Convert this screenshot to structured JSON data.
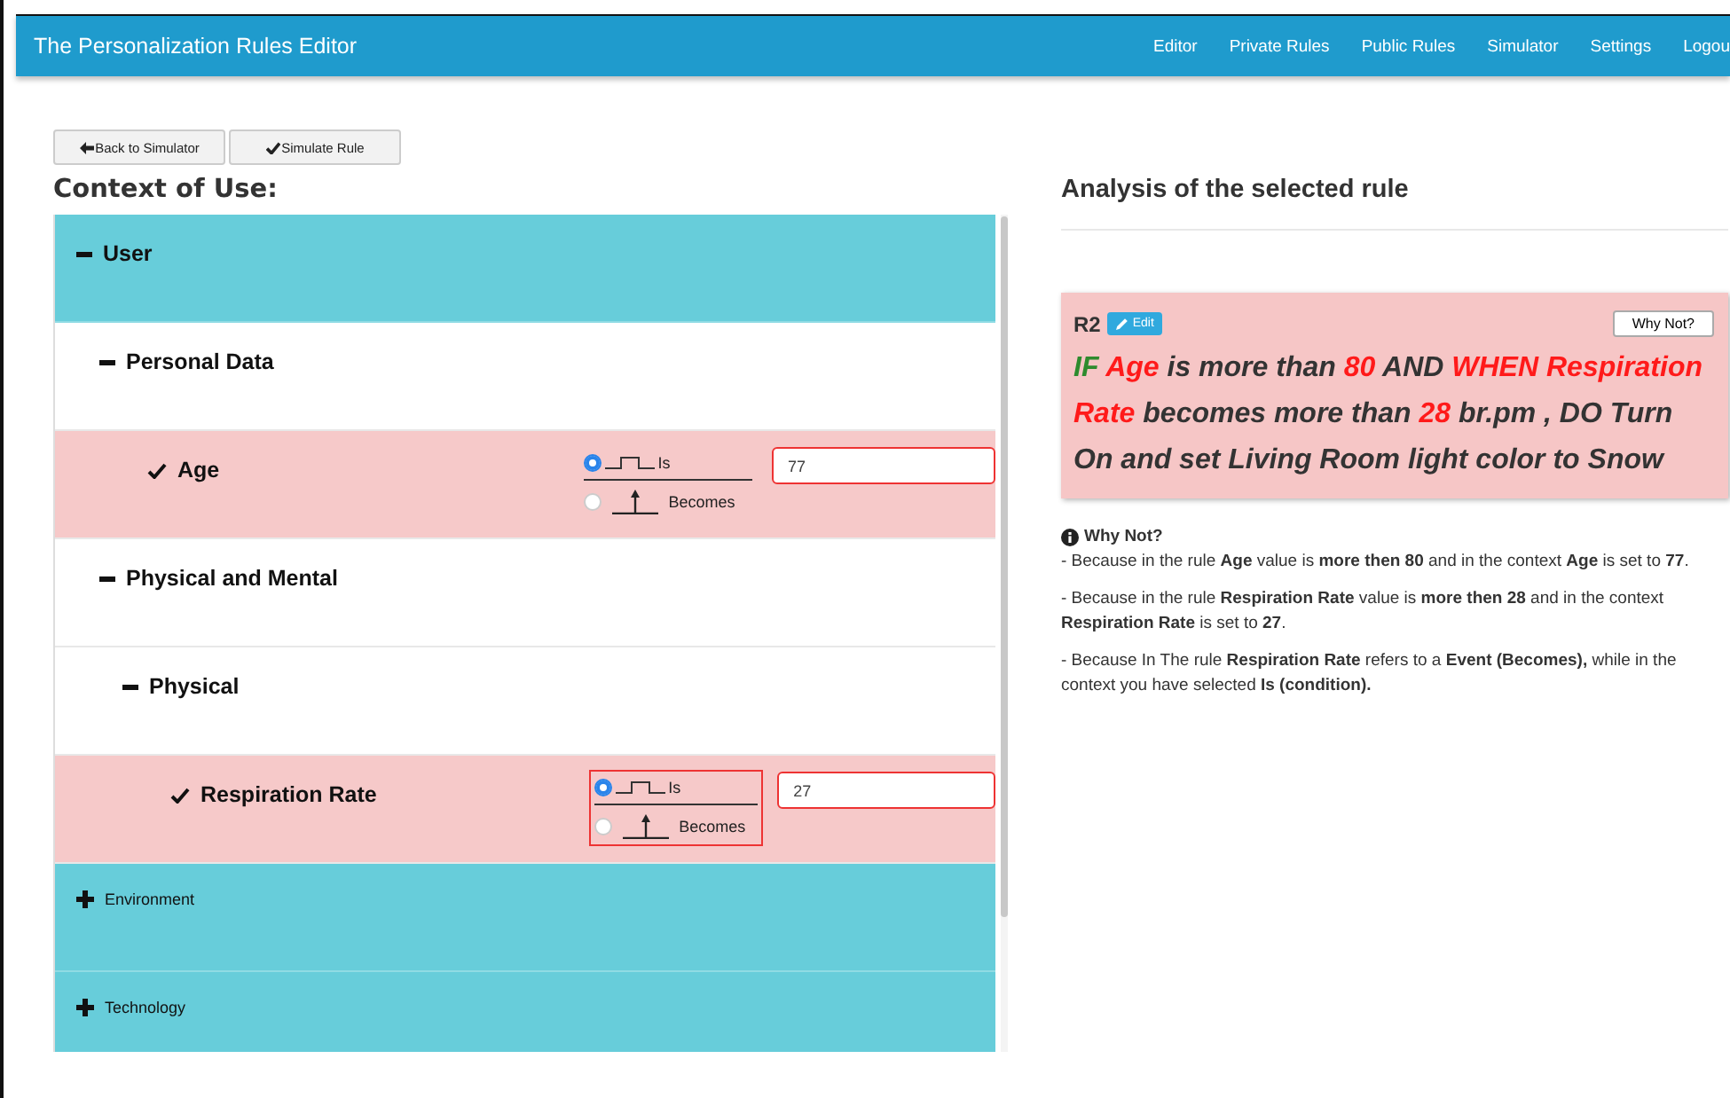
{
  "navbar": {
    "brand": "The Personalization Rules Editor",
    "links": [
      {
        "label": "Editor"
      },
      {
        "label": "Private Rules"
      },
      {
        "label": "Public Rules"
      },
      {
        "label": "Simulator"
      },
      {
        "label": "Settings"
      },
      {
        "label": "Logou"
      }
    ]
  },
  "toolbar": {
    "buttons": [
      {
        "label": "Back to Simulator",
        "kind": "back"
      },
      {
        "label": "Simulate Rule",
        "kind": "check"
      }
    ]
  },
  "context": {
    "title": "Context of Use:",
    "tree": [
      {
        "label": "User",
        "kind": "category",
        "expanded": true,
        "children": [
          {
            "label": "Personal Data",
            "kind": "group",
            "expanded": true,
            "children": [
              {
                "label": "Age",
                "kind": "property",
                "checked": true,
                "options": [
                  {
                    "label": "Is",
                    "selected": true
                  },
                  {
                    "label": "Becomes",
                    "selected": false
                  }
                ],
                "options_flagged": false,
                "value": "77",
                "value_flagged": true
              }
            ]
          },
          {
            "label": "Physical and Mental",
            "kind": "group",
            "expanded": true,
            "children": [
              {
                "label": "Physical",
                "kind": "group",
                "expanded": true,
                "children": [
                  {
                    "label": "Respiration Rate",
                    "kind": "property",
                    "checked": true,
                    "options": [
                      {
                        "label": "Is",
                        "selected": true
                      },
                      {
                        "label": "Becomes",
                        "selected": false
                      }
                    ],
                    "options_flagged": true,
                    "value": "27",
                    "value_flagged": true
                  }
                ]
              }
            ]
          }
        ]
      },
      {
        "label": "Environment",
        "kind": "category",
        "expanded": false
      },
      {
        "label": "Technology",
        "kind": "category",
        "expanded": false
      }
    ]
  },
  "analysis": {
    "title": "Analysis of the selected rule",
    "rule": {
      "id": "R2",
      "edit_label": "Edit",
      "why_button": "Why Not?",
      "segments": [
        {
          "text": "IF",
          "color": "#2e8b2e"
        },
        {
          "text": "Age",
          "color": "#ff1a1a"
        },
        {
          "text": "is more than",
          "color": "#333333"
        },
        {
          "text": "80",
          "color": "#ff1a1a"
        },
        {
          "text": "AND",
          "color": "#333333"
        },
        {
          "text": "WHEN",
          "color": "#ff1a1a"
        },
        {
          "text": "Respiration Rate",
          "color": "#ff1a1a"
        },
        {
          "text": "becomes more than",
          "color": "#333333"
        },
        {
          "text": "28",
          "color": "#ff1a1a"
        },
        {
          "text": "br.pm , DO Turn On and set Living Room light color to Snow",
          "color": "#333333"
        }
      ]
    },
    "why_not": {
      "title": "Why Not?",
      "reasons": [
        "- Because in the rule **Age** value is **more then 80** and in the context **Age** is set to **77**.",
        "- Because in the rule **Respiration Rate** value is **more then 28** and in the context **Respiration Rate** is set to **27**.",
        "- Because In The rule **Respiration Rate** refers to a **Event (Becomes),** while in the context you have selected **Is (condition).**"
      ]
    }
  }
}
